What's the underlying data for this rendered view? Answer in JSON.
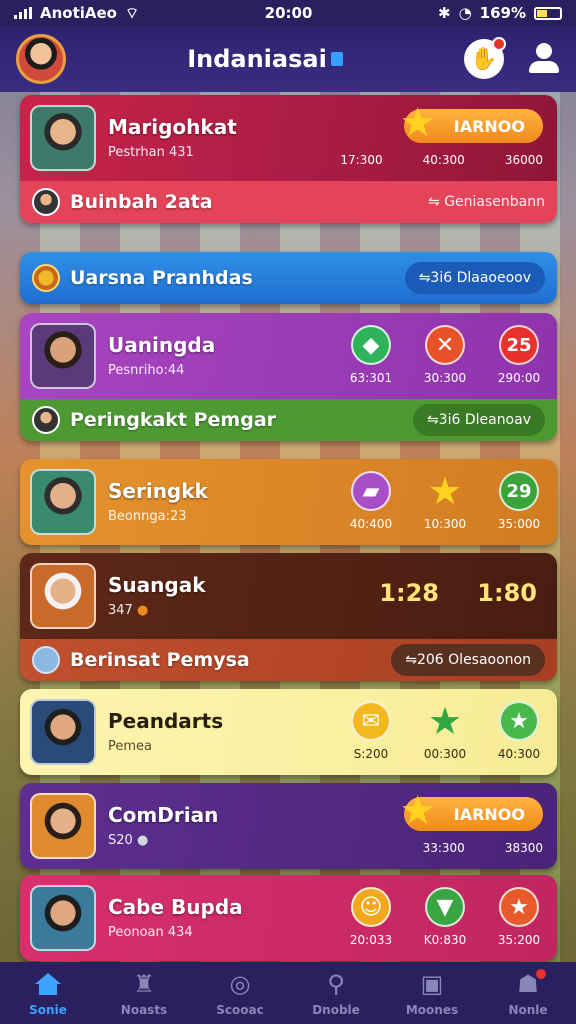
{
  "status": {
    "carrier": "AnotiAeo",
    "time": "20:00",
    "battery": "169%"
  },
  "header": {
    "title": "Indaniasai"
  },
  "cards": [
    {
      "name": "Marigohkat",
      "sub": "Pestrhan 431",
      "color": "#c9244a",
      "badge": "IARNOO",
      "values": [
        "17:300",
        "40:300",
        "36000"
      ],
      "row2": {
        "title": "Buinbah 2ata",
        "action": "Geniasenbann",
        "color": "#e34459"
      }
    },
    {
      "name": "Uaningda",
      "sub": "Pesnriho:44",
      "color": "#9e3eb0",
      "stats": [
        {
          "icon": "shield-icon",
          "glyph": "◆",
          "color": "#2fb35a",
          "value": "63:301"
        },
        {
          "icon": "cross-icon",
          "glyph": "✕",
          "color": "#e8522a",
          "value": "30:300"
        },
        {
          "icon": "level-icon",
          "glyph": "25",
          "color": "#e8302c",
          "value": "290:00"
        }
      ],
      "row2": {
        "title": "Peringkakt Pemgar",
        "action": "3i6 Dleanoav",
        "color": "#4d9a33"
      }
    },
    {
      "name": "Seringkk",
      "sub": "Beonnga:23",
      "color": "#e08a2e",
      "stats": [
        {
          "icon": "bag-icon",
          "glyph": "▰",
          "color": "#a84fc8",
          "value": "40:400"
        },
        {
          "icon": "star-icon",
          "glyph": "★",
          "color": "#f0b012",
          "value": "10:300"
        },
        {
          "icon": "level-icon",
          "glyph": "29",
          "color": "#3aa33a",
          "value": "35:000"
        }
      ]
    },
    {
      "name": "Suangak",
      "sub": "347",
      "color": "#5a2418",
      "scores": [
        "1:28",
        "1:80"
      ],
      "row2": {
        "title": "Berinsat Pemysa",
        "action": "206 Olesaoonon",
        "color": "#b8462e"
      }
    },
    {
      "name": "Peandarts",
      "sub": "Pemea",
      "color": "#fbf3a8",
      "stats": [
        {
          "icon": "badge-icon",
          "glyph": "✉",
          "color": "#f2b81e",
          "value": "S:200"
        },
        {
          "icon": "star-icon",
          "glyph": "★",
          "color": "#3ab04a",
          "value": "00:300"
        },
        {
          "icon": "star-icon",
          "glyph": "★",
          "color": "#49b84a",
          "value": "40:300"
        }
      ]
    },
    {
      "name": "ComDrian",
      "sub": "S20",
      "color": "#5a2d8a",
      "badge": "IARNOO",
      "values": [
        "33:300",
        "38300"
      ]
    },
    {
      "name": "Cabe Bupda",
      "sub": "Peonoan 434",
      "color": "#d42e6a",
      "stats": [
        {
          "icon": "smile-icon",
          "glyph": "☺",
          "color": "#f2a81e",
          "value": "20:033"
        },
        {
          "icon": "pin-icon",
          "glyph": "▼",
          "color": "#3ba544",
          "value": "K0:830"
        },
        {
          "icon": "star-icon",
          "glyph": "★",
          "color": "#e85a2a",
          "value": "35:200"
        }
      ]
    }
  ],
  "banner": {
    "title": "Uarsna Pranhdas",
    "action": "3i6 Dlaaoeoov"
  },
  "nav": [
    {
      "label": "Sonie",
      "icon": "home-icon"
    },
    {
      "label": "Noasts",
      "icon": "trophy-icon"
    },
    {
      "label": "Scooac",
      "icon": "search-icon"
    },
    {
      "label": "Dnoble",
      "icon": "magnify-icon"
    },
    {
      "label": "Moones",
      "icon": "wallet-icon"
    },
    {
      "label": "Nonle",
      "icon": "profile-icon"
    }
  ]
}
